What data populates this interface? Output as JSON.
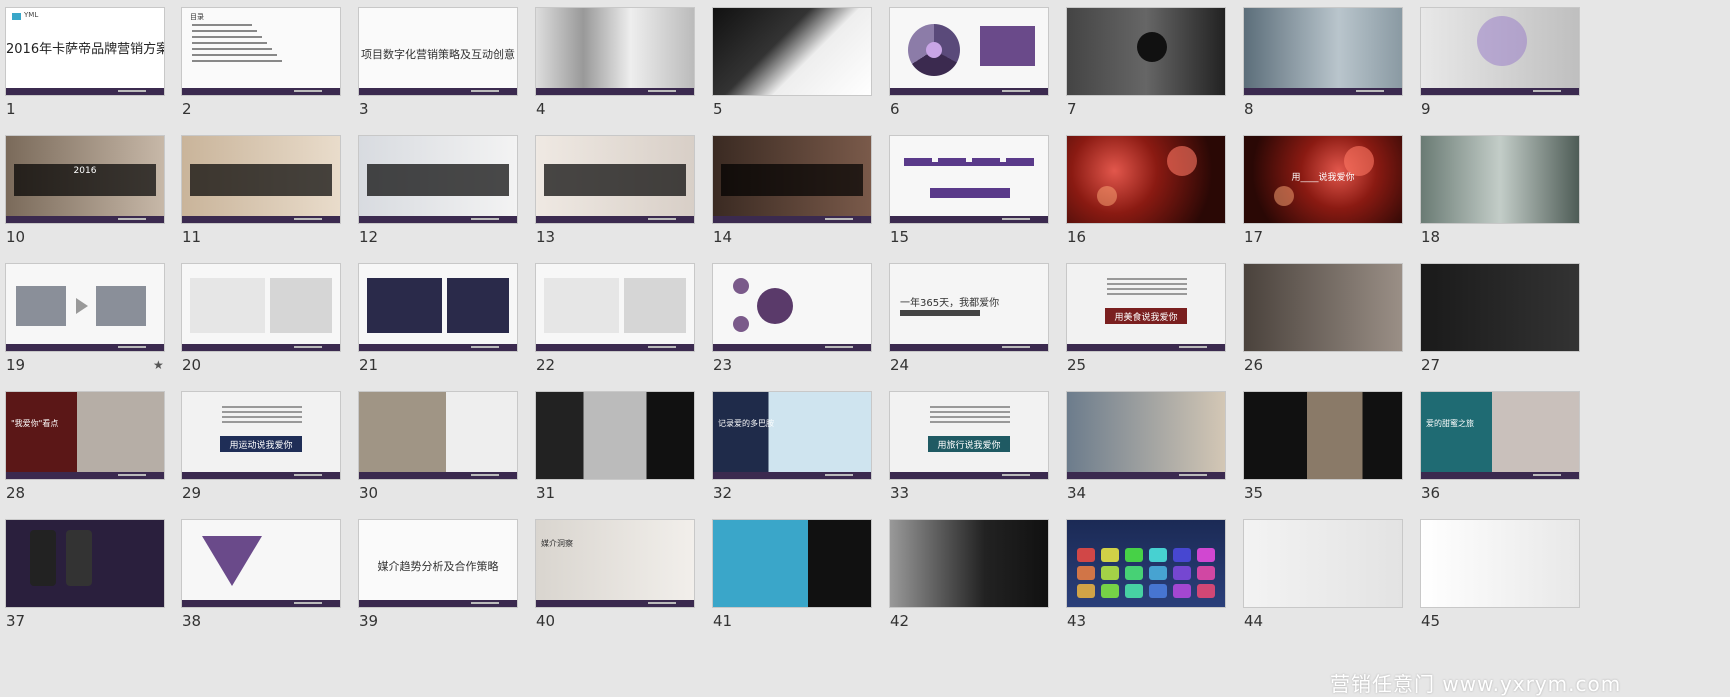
{
  "slides": [
    {
      "num": "1",
      "kind": "title",
      "text": "2016年卡萨帝品牌营销方案",
      "logo": "YML"
    },
    {
      "num": "2",
      "kind": "toc",
      "header": "目录"
    },
    {
      "num": "3",
      "kind": "center",
      "text": "项目数字化营销策略及互动创意"
    },
    {
      "num": "4",
      "kind": "photo-kitchen"
    },
    {
      "num": "5",
      "kind": "photo-dark-product"
    },
    {
      "num": "6",
      "kind": "pie"
    },
    {
      "num": "7",
      "kind": "family-dark"
    },
    {
      "num": "8",
      "kind": "window-photo"
    },
    {
      "num": "9",
      "kind": "kitchen-circle"
    },
    {
      "num": "10",
      "kind": "overlay-photo",
      "text": "2016"
    },
    {
      "num": "11",
      "kind": "food-overlay"
    },
    {
      "num": "12",
      "kind": "family-overlay"
    },
    {
      "num": "13",
      "kind": "mother-overlay"
    },
    {
      "num": "14",
      "kind": "dark-overlay"
    },
    {
      "num": "15",
      "kind": "purple-chart"
    },
    {
      "num": "16",
      "kind": "bokeh"
    },
    {
      "num": "17",
      "kind": "bokeh2",
      "text": "用____说我爱你"
    },
    {
      "num": "18",
      "kind": "forest"
    },
    {
      "num": "19",
      "kind": "arrow-photos",
      "star": "★"
    },
    {
      "num": "20",
      "kind": "web-grid"
    },
    {
      "num": "21",
      "kind": "web-dark"
    },
    {
      "num": "22",
      "kind": "web-photos"
    },
    {
      "num": "23",
      "kind": "purple-circles"
    },
    {
      "num": "24",
      "kind": "text-line",
      "text": "一年365天，我都爱你"
    },
    {
      "num": "25",
      "kind": "button",
      "text": "用美食说我爱你",
      "color": "#7a1f1f"
    },
    {
      "num": "26",
      "kind": "collage-dark"
    },
    {
      "num": "27",
      "kind": "oven-dark"
    },
    {
      "num": "28",
      "kind": "red-collage",
      "text": "\"我爱你\"看点"
    },
    {
      "num": "29",
      "kind": "button",
      "text": "用运动说我爱你",
      "color": "#1f2e57"
    },
    {
      "num": "30",
      "kind": "collage-people"
    },
    {
      "num": "31",
      "kind": "dark-shoe"
    },
    {
      "num": "32",
      "kind": "beach",
      "text": "记录爱的多巴胺"
    },
    {
      "num": "33",
      "kind": "button",
      "text": "用旅行说我爱你",
      "color": "#1f5a63"
    },
    {
      "num": "34",
      "kind": "travel-collage"
    },
    {
      "num": "35",
      "kind": "dark-product"
    },
    {
      "num": "36",
      "kind": "teal-macaron",
      "text": "爱的甜蜜之旅"
    },
    {
      "num": "37",
      "kind": "phones"
    },
    {
      "num": "38",
      "kind": "funnel"
    },
    {
      "num": "39",
      "kind": "center",
      "text": "媒介趋势分析及合作策略"
    },
    {
      "num": "40",
      "kind": "desk-photo",
      "text": "媒介洞察"
    },
    {
      "num": "41",
      "kind": "woman-phone"
    },
    {
      "num": "42",
      "kind": "bw-phone"
    },
    {
      "num": "43",
      "kind": "app-icons"
    },
    {
      "num": "44",
      "kind": "map-phone"
    },
    {
      "num": "45",
      "kind": "map-dark"
    }
  ],
  "watermark": "营销任意门 www.yxrym.com"
}
